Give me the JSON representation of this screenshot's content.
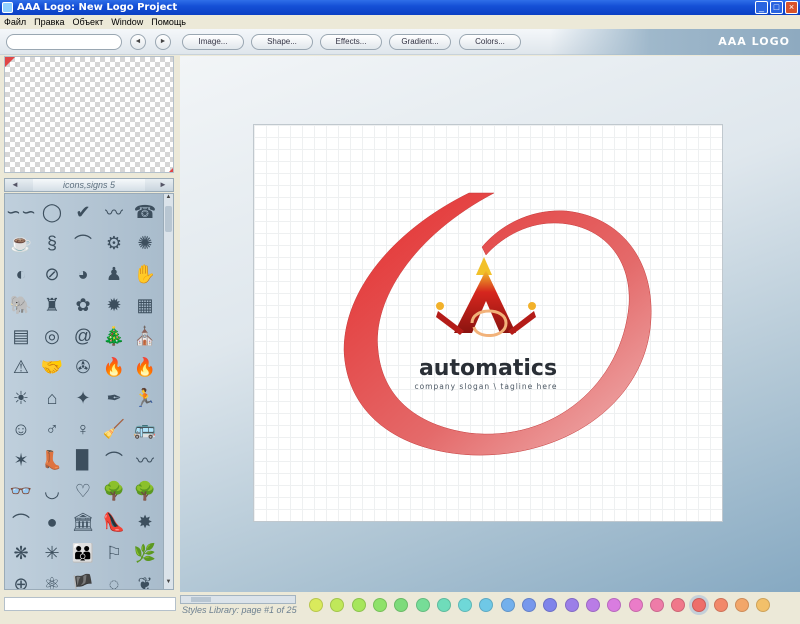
{
  "window": {
    "title": "AAA Logo: New Logo Project",
    "controls": [
      "_",
      "□",
      "×"
    ]
  },
  "menu": [
    "Файл",
    "Правка",
    "Объект",
    "Window",
    "Помощь"
  ],
  "toolbar": {
    "buttons": [
      "Image...",
      "Shape...",
      "Effects...",
      "Gradient...",
      "Colors..."
    ],
    "brand": "AAA LOGO",
    "prev": "◄",
    "next": "►"
  },
  "library": {
    "name": "icons,signs 5",
    "prev": "◄",
    "next": "►"
  },
  "icons": [
    "∽∽",
    "◯",
    "✔",
    "〰",
    "☎",
    "☕",
    "§",
    "⌒",
    "⚙",
    "✺",
    "◐",
    "⊘",
    "◕",
    "♟",
    "✋",
    "🐘",
    "♜",
    "✿",
    "✹",
    "▦",
    "▤",
    "◎",
    "@",
    "🎄",
    "⛪",
    "⚠",
    "🤝",
    "✇",
    "🔥",
    "🔥",
    "☀",
    "⌂",
    "✦",
    "✒",
    "🏃",
    "☺",
    "♂",
    "♀",
    "🧹",
    "🚌",
    "✶",
    "👢",
    "▉",
    "⌒",
    "〰",
    "👓",
    "◡",
    "♡",
    "🌳",
    "🌳",
    "⌒",
    "●",
    "🏛",
    "👠",
    "✸",
    "❋",
    "✳",
    "👪",
    "⚐",
    "🌿",
    "⊕",
    "⚛",
    "🏴",
    "◌",
    "❦",
    "⊞",
    "🐕"
  ],
  "logo": {
    "brand_name": "automatics",
    "slogan": "company slogan \\ tagline here"
  },
  "status": {
    "text": "Styles Library: page #1 of 25"
  },
  "palette": [
    "#d9ea5c",
    "#c0e85a",
    "#a6e65c",
    "#8ee26a",
    "#7ddb7a",
    "#76dd97",
    "#6fdcba",
    "#6fd8d8",
    "#6fc8e6",
    "#73b0ec",
    "#7798ec",
    "#7f84ea",
    "#9b7fe8",
    "#b97ce6",
    "#d97ce0",
    "#ea7cc8",
    "#ee7ca8",
    "#f0788a",
    "#ee6e6a",
    "#f2886a",
    "#f2a66a",
    "#f2c06a"
  ]
}
